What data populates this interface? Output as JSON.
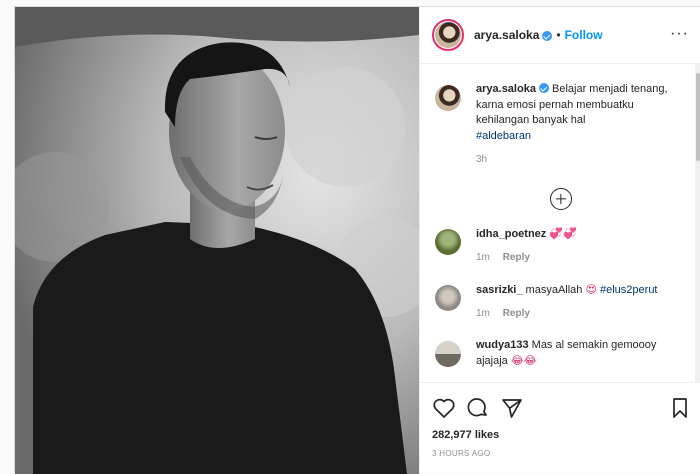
{
  "post": {
    "username": "arya.saloka",
    "follow_label": "Follow",
    "dot": "•",
    "more_label": "···"
  },
  "caption": {
    "username": "arya.saloka",
    "text": "Belajar menjadi tenang, karna emosi pernah membuatku kehilangan banyak hal",
    "hashtag": "#aldebaran",
    "time": "3h"
  },
  "comments": [
    {
      "username": "idha_poetnez",
      "text": "",
      "emoji": "💞💞",
      "time": "1m",
      "reply": "Reply"
    },
    {
      "username": "sasrizki_",
      "text": "masyaAllah",
      "emoji": "😍",
      "hashtag": "#elus2perut",
      "time": "1m",
      "reply": "Reply"
    },
    {
      "username": "wudya133",
      "text": "Mas al semakin gemoooy",
      "text2": "ajajaja",
      "emoji": "😂😂"
    }
  ],
  "footer": {
    "likes": "282,977 likes",
    "posted": "3 HOURS AGO"
  },
  "colors": {
    "accent": "#0095f6",
    "verified": "#3897f0",
    "muted": "#8e8e8e"
  }
}
